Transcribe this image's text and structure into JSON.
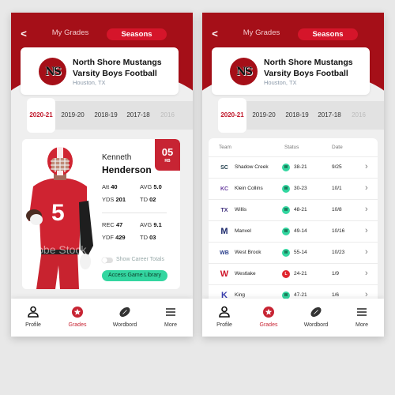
{
  "colors": {
    "brand_red": "#a50f18",
    "accent_red": "#c72433",
    "win_green": "#33d6a0",
    "loss_red": "#e0262f"
  },
  "header": {
    "back_icon": "chevron-left-icon",
    "back_glyph": "<",
    "tabs": [
      {
        "label": "My Grades",
        "active": false
      },
      {
        "label": "Seasons",
        "active": true
      }
    ]
  },
  "team": {
    "logo_text": "NS",
    "name": "North Shore Mustangs Varsity Boys Football",
    "location": "Houston, TX"
  },
  "seasons": [
    "2020-21",
    "2019-20",
    "2018-19",
    "2017-18",
    "2016"
  ],
  "selected_season": "2020-21",
  "player": {
    "first_name": "Kenneth",
    "last_name": "Henderson",
    "jersey_number": "05",
    "position": "RB",
    "jersey_shown": "5",
    "watermark": "Adobe Stock",
    "rushing": [
      {
        "label": "Att",
        "value": "40"
      },
      {
        "label": "AVG",
        "value": "5.0"
      },
      {
        "label": "YDS",
        "value": "201"
      },
      {
        "label": "TD",
        "value": "02"
      }
    ],
    "receiving": [
      {
        "label": "REC",
        "value": "47"
      },
      {
        "label": "AVG",
        "value": "9.1"
      },
      {
        "label": "YDF",
        "value": "429"
      },
      {
        "label": "TD",
        "value": "03"
      }
    ],
    "career_toggle_label": "Show Career Totals",
    "career_toggle_on": false,
    "game_library_button": "Access Game Library"
  },
  "results": {
    "columns": [
      "Team",
      "Status",
      "Date"
    ],
    "rows": [
      {
        "team": "Shadow Creek",
        "logo": "SC",
        "result": "W",
        "score": "38-21",
        "date": "9/25"
      },
      {
        "team": "Klein Collins",
        "logo": "KC",
        "result": "W",
        "score": "30-23",
        "date": "10/1"
      },
      {
        "team": "Willis",
        "logo": "TX",
        "result": "W",
        "score": "48-21",
        "date": "10/8"
      },
      {
        "team": "Manvel",
        "logo": "M",
        "result": "W",
        "score": "49-14",
        "date": "10/16"
      },
      {
        "team": "West Brook",
        "logo": "WB",
        "result": "W",
        "score": "55-14",
        "date": "10/23"
      },
      {
        "team": "Westlake",
        "logo": "W",
        "result": "L",
        "score": "24-21",
        "date": "1/9"
      },
      {
        "team": "King",
        "logo": "K",
        "result": "W",
        "score": "47-21",
        "date": "1/6"
      }
    ],
    "chevron": "›"
  },
  "bottom_nav": [
    {
      "label": "Profile",
      "icon": "person-icon",
      "active": false
    },
    {
      "label": "Grades",
      "icon": "star-badge-icon",
      "active": true
    },
    {
      "label": "Wordbord",
      "icon": "football-icon",
      "active": false
    },
    {
      "label": "More",
      "icon": "menu-icon",
      "active": false
    }
  ]
}
